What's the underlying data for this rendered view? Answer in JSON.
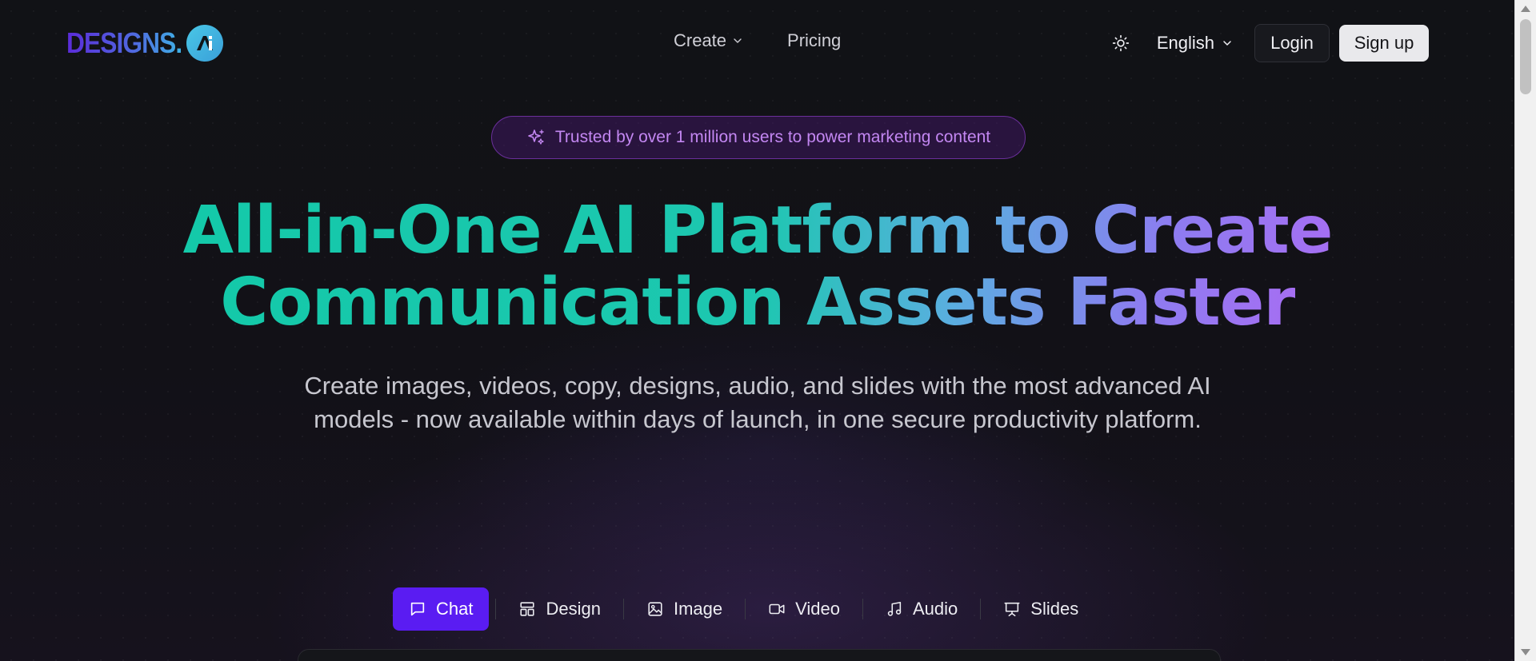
{
  "brand": {
    "name": "DESIGNS.",
    "badge": "AI"
  },
  "nav": {
    "items": [
      {
        "label": "Create",
        "has_dropdown": true
      },
      {
        "label": "Pricing",
        "has_dropdown": false
      }
    ],
    "theme_icon": "sun-icon",
    "language": "English",
    "login_label": "Login",
    "signup_label": "Sign up"
  },
  "hero": {
    "badge_text": "Trusted by over 1 million users to power marketing content",
    "badge_icon": "sparkles-icon",
    "headline_line1": "All-in-One AI Platform to Create",
    "headline_line2": "Communication Assets Faster",
    "subheadline": "Create images, videos, copy, designs, audio, and slides with the most advanced AI models - now available within days of launch, in one secure productivity platform."
  },
  "tabs": [
    {
      "label": "Chat",
      "icon": "chat-icon",
      "active": true
    },
    {
      "label": "Design",
      "icon": "layout-icon",
      "active": false
    },
    {
      "label": "Image",
      "icon": "image-icon",
      "active": false
    },
    {
      "label": "Video",
      "icon": "video-icon",
      "active": false
    },
    {
      "label": "Audio",
      "icon": "music-icon",
      "active": false
    },
    {
      "label": "Slides",
      "icon": "presentation-icon",
      "active": false
    }
  ],
  "colors": {
    "accent": "#5a1cf2",
    "badge_text": "#c387f2",
    "headline_start": "#14c9a9",
    "headline_end": "#a56ff2"
  }
}
